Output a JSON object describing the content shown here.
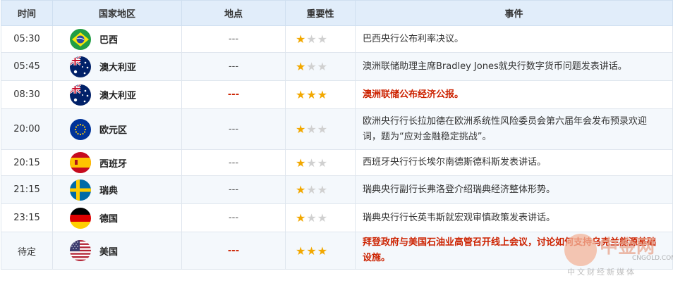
{
  "headers": {
    "time": "时间",
    "country": "国家地区",
    "location": "地点",
    "importance": "重要性",
    "event": "事件"
  },
  "rows": [
    {
      "time": "05:30",
      "country": "巴西",
      "flag": "brazil-flag-icon",
      "location": "---",
      "stars": 1,
      "event": "巴西央行公布利率决议。",
      "high": false
    },
    {
      "time": "05:45",
      "country": "澳大利亚",
      "flag": "australia-flag-icon",
      "location": "---",
      "stars": 1,
      "event": "澳洲联储助理主席Bradley Jones就央行数字货币问题发表讲话。",
      "high": false
    },
    {
      "time": "08:30",
      "country": "澳大利亚",
      "flag": "australia-flag-icon",
      "location": "---",
      "stars": 3,
      "event": "澳洲联储公布经济公报。",
      "high": true
    },
    {
      "time": "20:00",
      "country": "欧元区",
      "flag": "eu-flag-icon",
      "location": "---",
      "stars": 1,
      "event": "欧洲央行行长拉加德在欧洲系统性风险委员会第六届年会发布预录欢迎词，题为“应对金融稳定挑战”。",
      "high": false
    },
    {
      "time": "20:15",
      "country": "西班牙",
      "flag": "spain-flag-icon",
      "location": "---",
      "stars": 1,
      "event": "西班牙央行行长埃尔南德斯德科斯发表讲话。",
      "high": false
    },
    {
      "time": "21:15",
      "country": "瑞典",
      "flag": "sweden-flag-icon",
      "location": "---",
      "stars": 1,
      "event": "瑞典央行副行长弗洛登介绍瑞典经济整体形势。",
      "high": false
    },
    {
      "time": "23:15",
      "country": "德国",
      "flag": "germany-flag-icon",
      "location": "---",
      "stars": 1,
      "event": "瑞典央行行长英韦斯就宏观审慎政策发表讲话。",
      "high": false
    },
    {
      "time": "待定",
      "country": "美国",
      "flag": "usa-flag-icon",
      "location": "---",
      "stars": 3,
      "event": "拜登政府与美国石油业高管召开线上会议，讨论如何支持乌克兰能源基础设施。",
      "high": true
    }
  ],
  "watermark": {
    "brand": "中金网",
    "url": "CNGOLD.COM.CN",
    "sub": "中文财经新媒体"
  }
}
